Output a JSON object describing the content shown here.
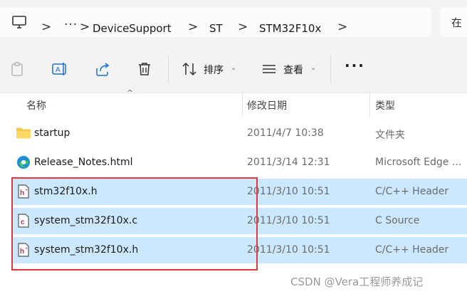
{
  "breadcrumb": {
    "overflow": "···",
    "items": [
      "DeviceSupport",
      "ST",
      "STM32F10x"
    ],
    "separator": ">"
  },
  "search": {
    "placeholder": "在"
  },
  "toolbar": {
    "sort_label": "排序",
    "view_label": "查看",
    "more_label": "···",
    "caret": "⌄",
    "icons": [
      "paste-icon",
      "rename-icon",
      "share-icon",
      "delete-icon",
      "sort-icon",
      "view-icon"
    ]
  },
  "columns": {
    "name": "名称",
    "date": "修改日期",
    "type": "类型",
    "sort_indicator": "^"
  },
  "files": [
    {
      "name": "startup",
      "date": "2011/4/7 10:38",
      "type": "文件夹",
      "icon": "folder-icon",
      "selected": false
    },
    {
      "name": "Release_Notes.html",
      "date": "2011/3/14 12:31",
      "type": "Microsoft Edge ...",
      "icon": "edge-html-icon",
      "selected": false
    },
    {
      "name": "stm32f10x.h",
      "date": "2011/3/10 10:51",
      "type": "C/C++ Header",
      "icon": "header-file-icon",
      "selected": true
    },
    {
      "name": "system_stm32f10x.c",
      "date": "2011/3/10 10:51",
      "type": "C Source",
      "icon": "c-source-file-icon",
      "selected": true
    },
    {
      "name": "system_stm32f10x.h",
      "date": "2011/3/10 10:51",
      "type": "C/C++ Header",
      "icon": "header-file-icon",
      "selected": true
    }
  ],
  "watermark": "CSDN @Vera工程师养成记",
  "colors": {
    "selection": "#cce8ff",
    "highlight_box": "#e0393e",
    "folder": "#f7c948"
  }
}
